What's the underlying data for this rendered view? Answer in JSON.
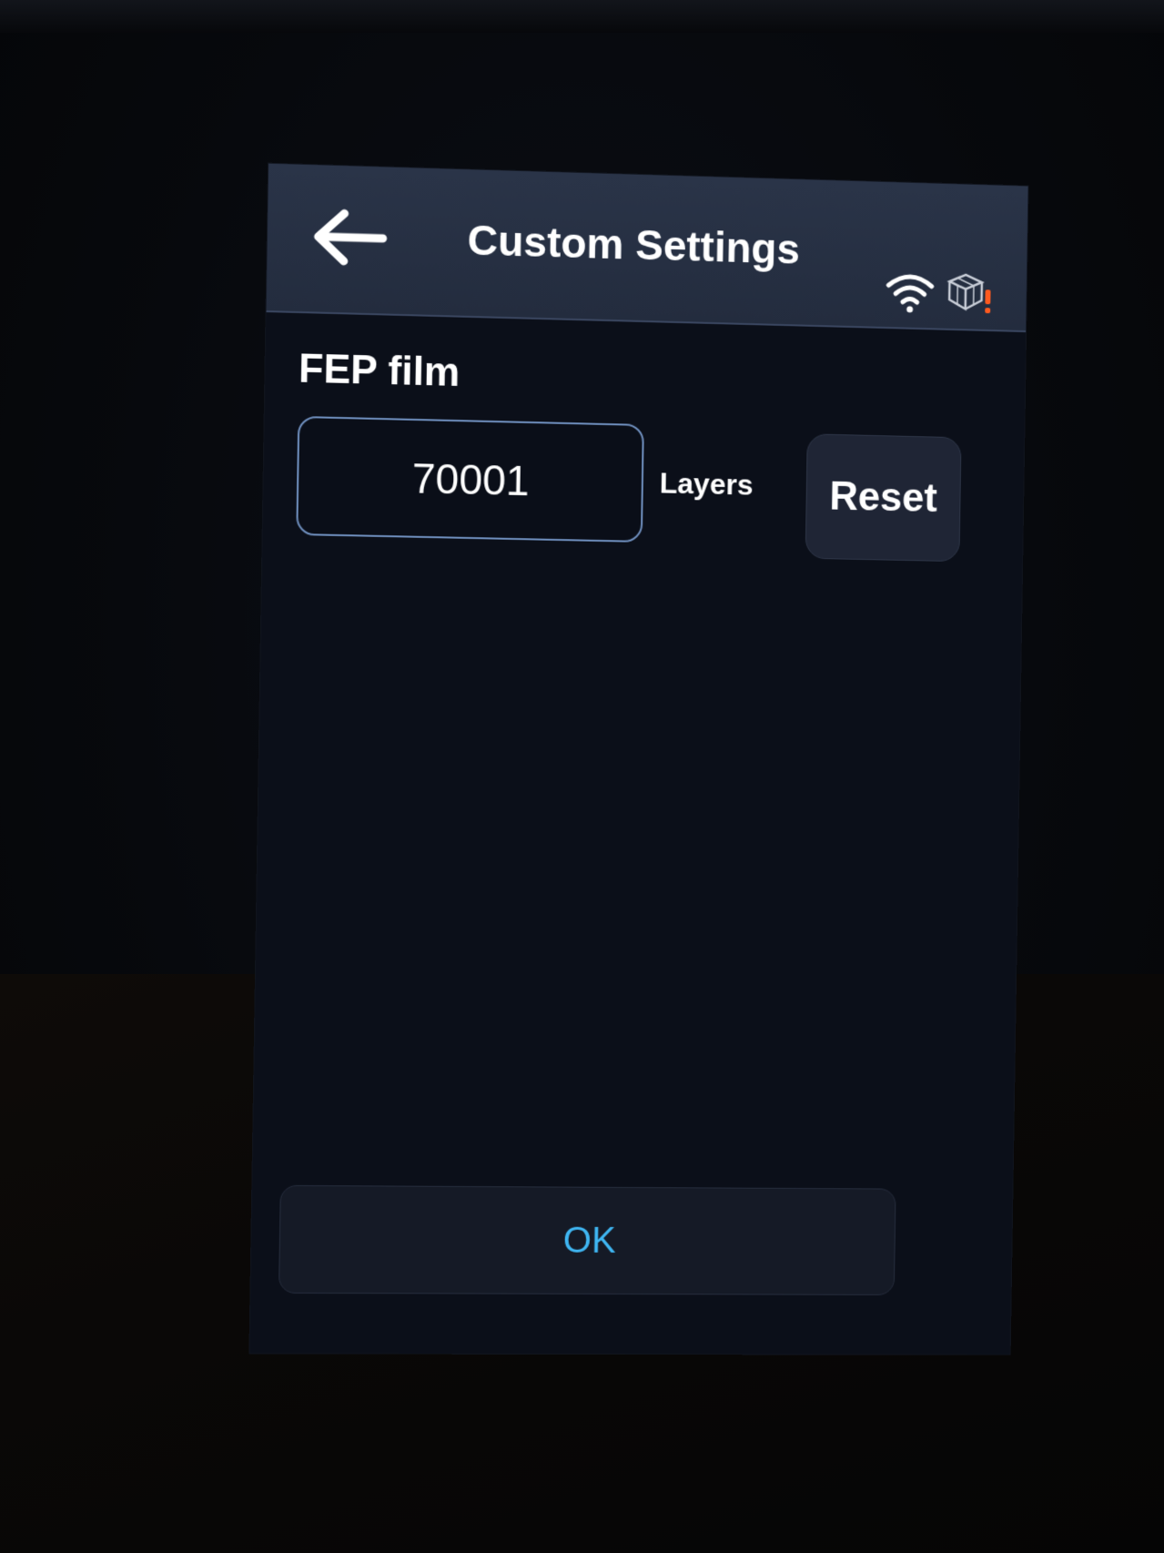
{
  "header": {
    "title": "Custom Settings",
    "back_icon": "arrow-left-icon",
    "wifi_icon": "wifi-icon",
    "resin_status_icon": "resin-box-warning-icon"
  },
  "setting": {
    "label": "FEP film",
    "value": "70001",
    "unit": "Layers",
    "reset_label": "Reset"
  },
  "footer": {
    "ok_label": "OK"
  },
  "colors": {
    "header_bg": "#2a3448",
    "screen_bg": "#0b0f19",
    "accent": "#3fb6f2",
    "field_border": "#6f8fbe",
    "warning": "#ff5a1f"
  }
}
